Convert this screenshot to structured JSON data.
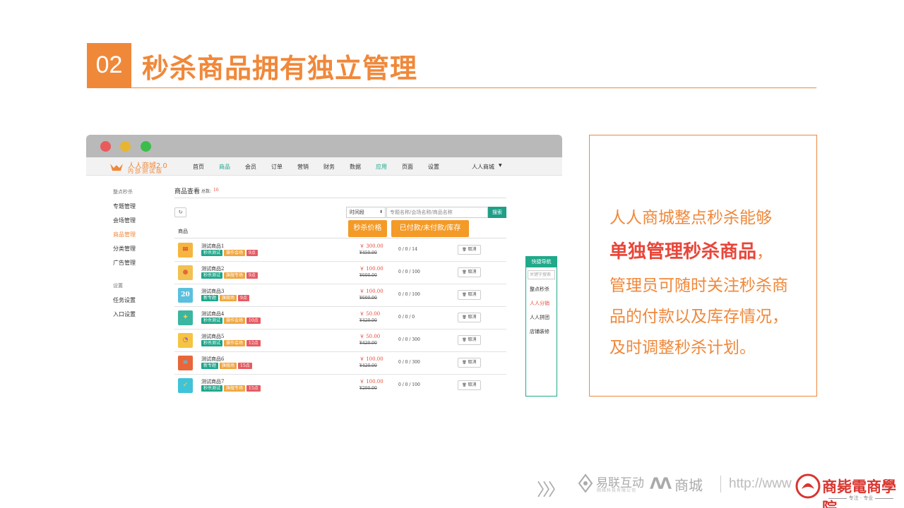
{
  "slide": {
    "number": "02",
    "title": "秒杀商品拥有独立管理"
  },
  "app": {
    "logo_line1": "人人商城2.0",
    "logo_line2": "内部测试版",
    "nav": [
      "首页",
      "商品",
      "会员",
      "订单",
      "营销",
      "财务",
      "数据",
      "应用",
      "页面",
      "设置"
    ],
    "nav_active": [
      "商品",
      "应用"
    ],
    "user_menu": "人人商城"
  },
  "sidebar": {
    "section1": "整点秒杀",
    "items1": [
      "专题管理",
      "会场管理",
      "商品管理",
      "分类管理",
      "广告管理"
    ],
    "active_item": "商品管理",
    "section2": "设置",
    "items2": [
      "任务设置",
      "入口设置"
    ]
  },
  "main": {
    "title": "商品查看",
    "count_label": "总数:",
    "count_value": "16",
    "refresh_icon": "↻",
    "time_select": "时间段",
    "search_placeholder": "专题名称/会场名称/商品名称",
    "search_button": "搜索",
    "column_product": "商品",
    "callout_price": "秒杀价格",
    "callout_stock": "已付款/未付款/库存",
    "cancel_label": "取消",
    "cancel_icon": "🗑"
  },
  "rows": [
    {
      "name": "测试商品1",
      "tags": [
        "秒杀测试",
        "操作会场",
        "9点"
      ],
      "tag_colors": [
        "#1fa68b",
        "#f0a640",
        "#e55b63"
      ],
      "price": "￥ 300.00",
      "orig": "¥450.00",
      "stock": "0 / 0 / 14",
      "icon": "mail-icon",
      "thumb_bg": "#f6b540",
      "thumb_fg": "#e0463a"
    },
    {
      "name": "测试商品2",
      "tags": [
        "秒杀测试",
        "旗舰专场",
        "9点"
      ],
      "tag_colors": [
        "#1fa68b",
        "#f0a640",
        "#e55b63"
      ],
      "price": "￥ 100.00",
      "orig": "¥600.00",
      "stock": "0 / 0 / 100",
      "icon": "location-pin-icon",
      "thumb_bg": "#f1c152",
      "thumb_fg": "#e8663a"
    },
    {
      "name": "测试商品3",
      "tags": [
        "新专题",
        "旗舰场",
        "9点"
      ],
      "tag_colors": [
        "#1fa68b",
        "#f0a640",
        "#e55b63"
      ],
      "price": "￥ 100.00",
      "orig": "¥600.00",
      "stock": "0 / 0 / 100",
      "icon": "calendar-icon",
      "thumb_bg": "#5bc0de",
      "thumb_fg": "#ffffff"
    },
    {
      "name": "测试商品4",
      "tags": [
        "秒杀测试",
        "操作会场",
        "10点"
      ],
      "tag_colors": [
        "#1fa68b",
        "#f0a640",
        "#e55b63"
      ],
      "price": "￥ 50.00",
      "orig": "¥420.00",
      "stock": "0 / 0 / 0",
      "icon": "idea-icon",
      "thumb_bg": "#3bb6a0",
      "thumb_fg": "#f6d04d"
    },
    {
      "name": "测试商品5",
      "tags": [
        "秒杀测试",
        "操作会场",
        "12点"
      ],
      "tag_colors": [
        "#1fa68b",
        "#f0a640",
        "#e55b63"
      ],
      "price": "￥ 50.00",
      "orig": "¥420.00",
      "stock": "0 / 0 / 300",
      "icon": "pie-chart-icon",
      "thumb_bg": "#f6c443",
      "thumb_fg": "#9b59b6"
    },
    {
      "name": "测试商品6",
      "tags": [
        "新专题",
        "旗舰场",
        "15点"
      ],
      "tag_colors": [
        "#1fa68b",
        "#f0a640",
        "#e55b63"
      ],
      "price": "￥ 100.00",
      "orig": "¥420.00",
      "stock": "0 / 0 / 300",
      "icon": "layers-icon",
      "thumb_bg": "#e8663a",
      "thumb_fg": "#5bc0de"
    },
    {
      "name": "测试商品7",
      "tags": [
        "秒杀测试",
        "旗舰专场",
        "15点"
      ],
      "tag_colors": [
        "#1fa68b",
        "#f0a640",
        "#e55b63"
      ],
      "price": "￥ 100.00",
      "orig": "¥200.00",
      "stock": "0 / 0 / 100",
      "icon": "badge-icon",
      "thumb_bg": "#3fc3d8",
      "thumb_fg": "#f6c443"
    }
  ],
  "quick_nav": {
    "title": "快捷导航",
    "search_placeholder": "关键字搜索",
    "items": [
      "整点秒杀",
      "人人分销",
      "人人拼团",
      "店铺装修"
    ],
    "active_item": "人人分销"
  },
  "description": {
    "line1": "人人商城整点秒杀能够",
    "line2_strong": "单独管理秒杀商品",
    "line2_tail": "，",
    "line3": "管理员可随时关注秒杀商",
    "line4": "品的付款以及库存情况，",
    "line5": "及时调整秒杀计划。"
  },
  "footer": {
    "chevrons": "〉〉〉",
    "brand1_name": "易联互动",
    "brand1_sub": "网络科技有限公司",
    "brand2_name": "商城",
    "url": "http://www",
    "brand3_name": "商毙電商學院",
    "brand3_sub": "专注 · 专业"
  },
  "colors": {
    "accent": "#f0883a",
    "highlight": "#e8463a",
    "app_green": "#20a98a",
    "callout": "#f39a27"
  }
}
